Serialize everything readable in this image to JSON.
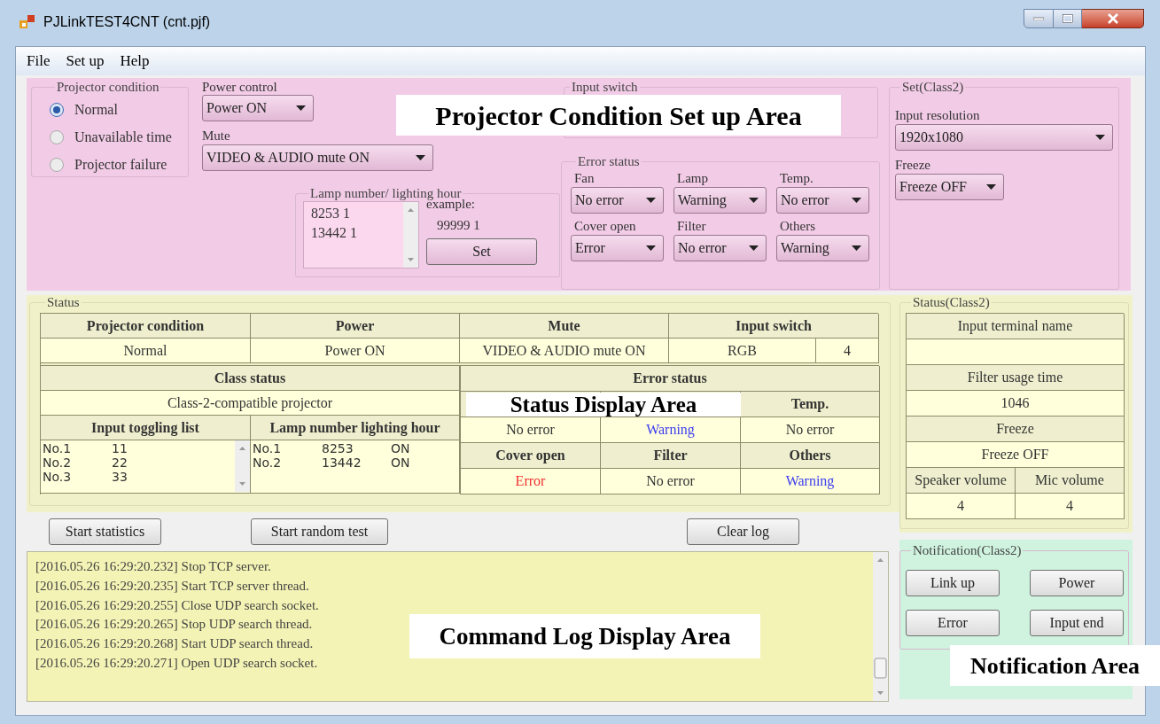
{
  "window": {
    "title": "PJLinkTEST4CNT (cnt.pjf)"
  },
  "menu": [
    {
      "label": "File"
    },
    {
      "label": "Set up"
    },
    {
      "label": "Help"
    }
  ],
  "setup": {
    "callout": "Projector Condition Set up Area",
    "projector_condition": {
      "title": "Projector condition",
      "options": [
        {
          "label": "Normal",
          "selected": true
        },
        {
          "label": "Unavailable time",
          "selected": false
        },
        {
          "label": "Projector failure",
          "selected": false
        }
      ]
    },
    "power_control": {
      "label": "Power control",
      "value": "Power ON"
    },
    "mute": {
      "label": "Mute",
      "value": "VIDEO & AUDIO mute ON"
    },
    "lamp": {
      "title": "Lamp number/ lighting hour",
      "lines": [
        "8253 1",
        "13442 1"
      ],
      "example_label": "example:",
      "example": "99999 1",
      "button": "Set"
    },
    "input_switch": {
      "title": "Input switch"
    },
    "error_status": {
      "title": "Error status",
      "fields": [
        {
          "label": "Fan",
          "value": "No error"
        },
        {
          "label": "Lamp",
          "value": "Warning"
        },
        {
          "label": "Temp.",
          "value": "No error"
        },
        {
          "label": "Cover open",
          "value": "Error"
        },
        {
          "label": "Filter",
          "value": "No error"
        },
        {
          "label": "Others",
          "value": "Warning"
        }
      ]
    },
    "set_class2": {
      "title": "Set(Class2)",
      "fields": [
        {
          "label": "Input resolution",
          "value": "1920x1080"
        },
        {
          "label": "Freeze",
          "value": "Freeze OFF"
        }
      ]
    }
  },
  "status": {
    "title": "Status",
    "callout": "Status Display Area",
    "columns": [
      "Projector condition",
      "Power",
      "Mute",
      "Input switch"
    ],
    "values": [
      "Normal",
      "Power ON",
      "VIDEO & AUDIO mute ON"
    ],
    "input_switch_values": [
      "RGB",
      "4"
    ],
    "class_status": {
      "header": "Class status",
      "value": "Class-2-compatible projector"
    },
    "input_toggling": {
      "header": "Input toggling list",
      "rows": [
        [
          "No.1",
          "11"
        ],
        [
          "No.2",
          "22"
        ],
        [
          "No.3",
          "33"
        ]
      ]
    },
    "lamp_hours": {
      "header": "Lamp number lighting hour",
      "rows": [
        [
          "No.1",
          "8253",
          "ON"
        ],
        [
          "No.2",
          "13442",
          "ON"
        ]
      ]
    },
    "error_status": {
      "header": "Error status",
      "items": [
        {
          "value": "No error",
          "kind": "ok"
        },
        {
          "value": "Warning",
          "kind": "warning"
        },
        {
          "label": "Temp.",
          "value": "No error",
          "kind": "ok"
        },
        {
          "label": "Cover open",
          "value": "Error",
          "kind": "error"
        },
        {
          "label": "Filter",
          "value": "No error",
          "kind": "ok"
        },
        {
          "label": "Others",
          "value": "Warning",
          "kind": "warning"
        }
      ]
    }
  },
  "buttons": [
    "Start statistics",
    "Start random test",
    "Clear log"
  ],
  "status_class2": {
    "title": "Status(Class2)",
    "rows": [
      {
        "header": "Input terminal name"
      },
      {
        "header": "Filter usage time",
        "value": "1046"
      },
      {
        "header": "Freeze",
        "value": "Freeze OFF"
      }
    ],
    "volumes": [
      {
        "header": "Speaker volume",
        "value": "4"
      },
      {
        "header": "Mic volume",
        "value": "4"
      }
    ]
  },
  "log": {
    "callout": "Command Log Display Area",
    "lines": [
      "[2016.05.26 16:29:20.232] Stop TCP server.",
      "[2016.05.26 16:29:20.235] Start TCP server thread.",
      "[2016.05.26 16:29:20.255] Close UDP search socket.",
      "[2016.05.26 16:29:20.265] Stop UDP search thread.",
      "[2016.05.26 16:29:20.268] Start UDP search thread.",
      "[2016.05.26 16:29:20.271] Open UDP search socket."
    ]
  },
  "notification": {
    "title": "Notification(Class2)",
    "callout": "Notification Area",
    "buttons": [
      "Link up",
      "Power",
      "Error",
      "Input end"
    ]
  }
}
